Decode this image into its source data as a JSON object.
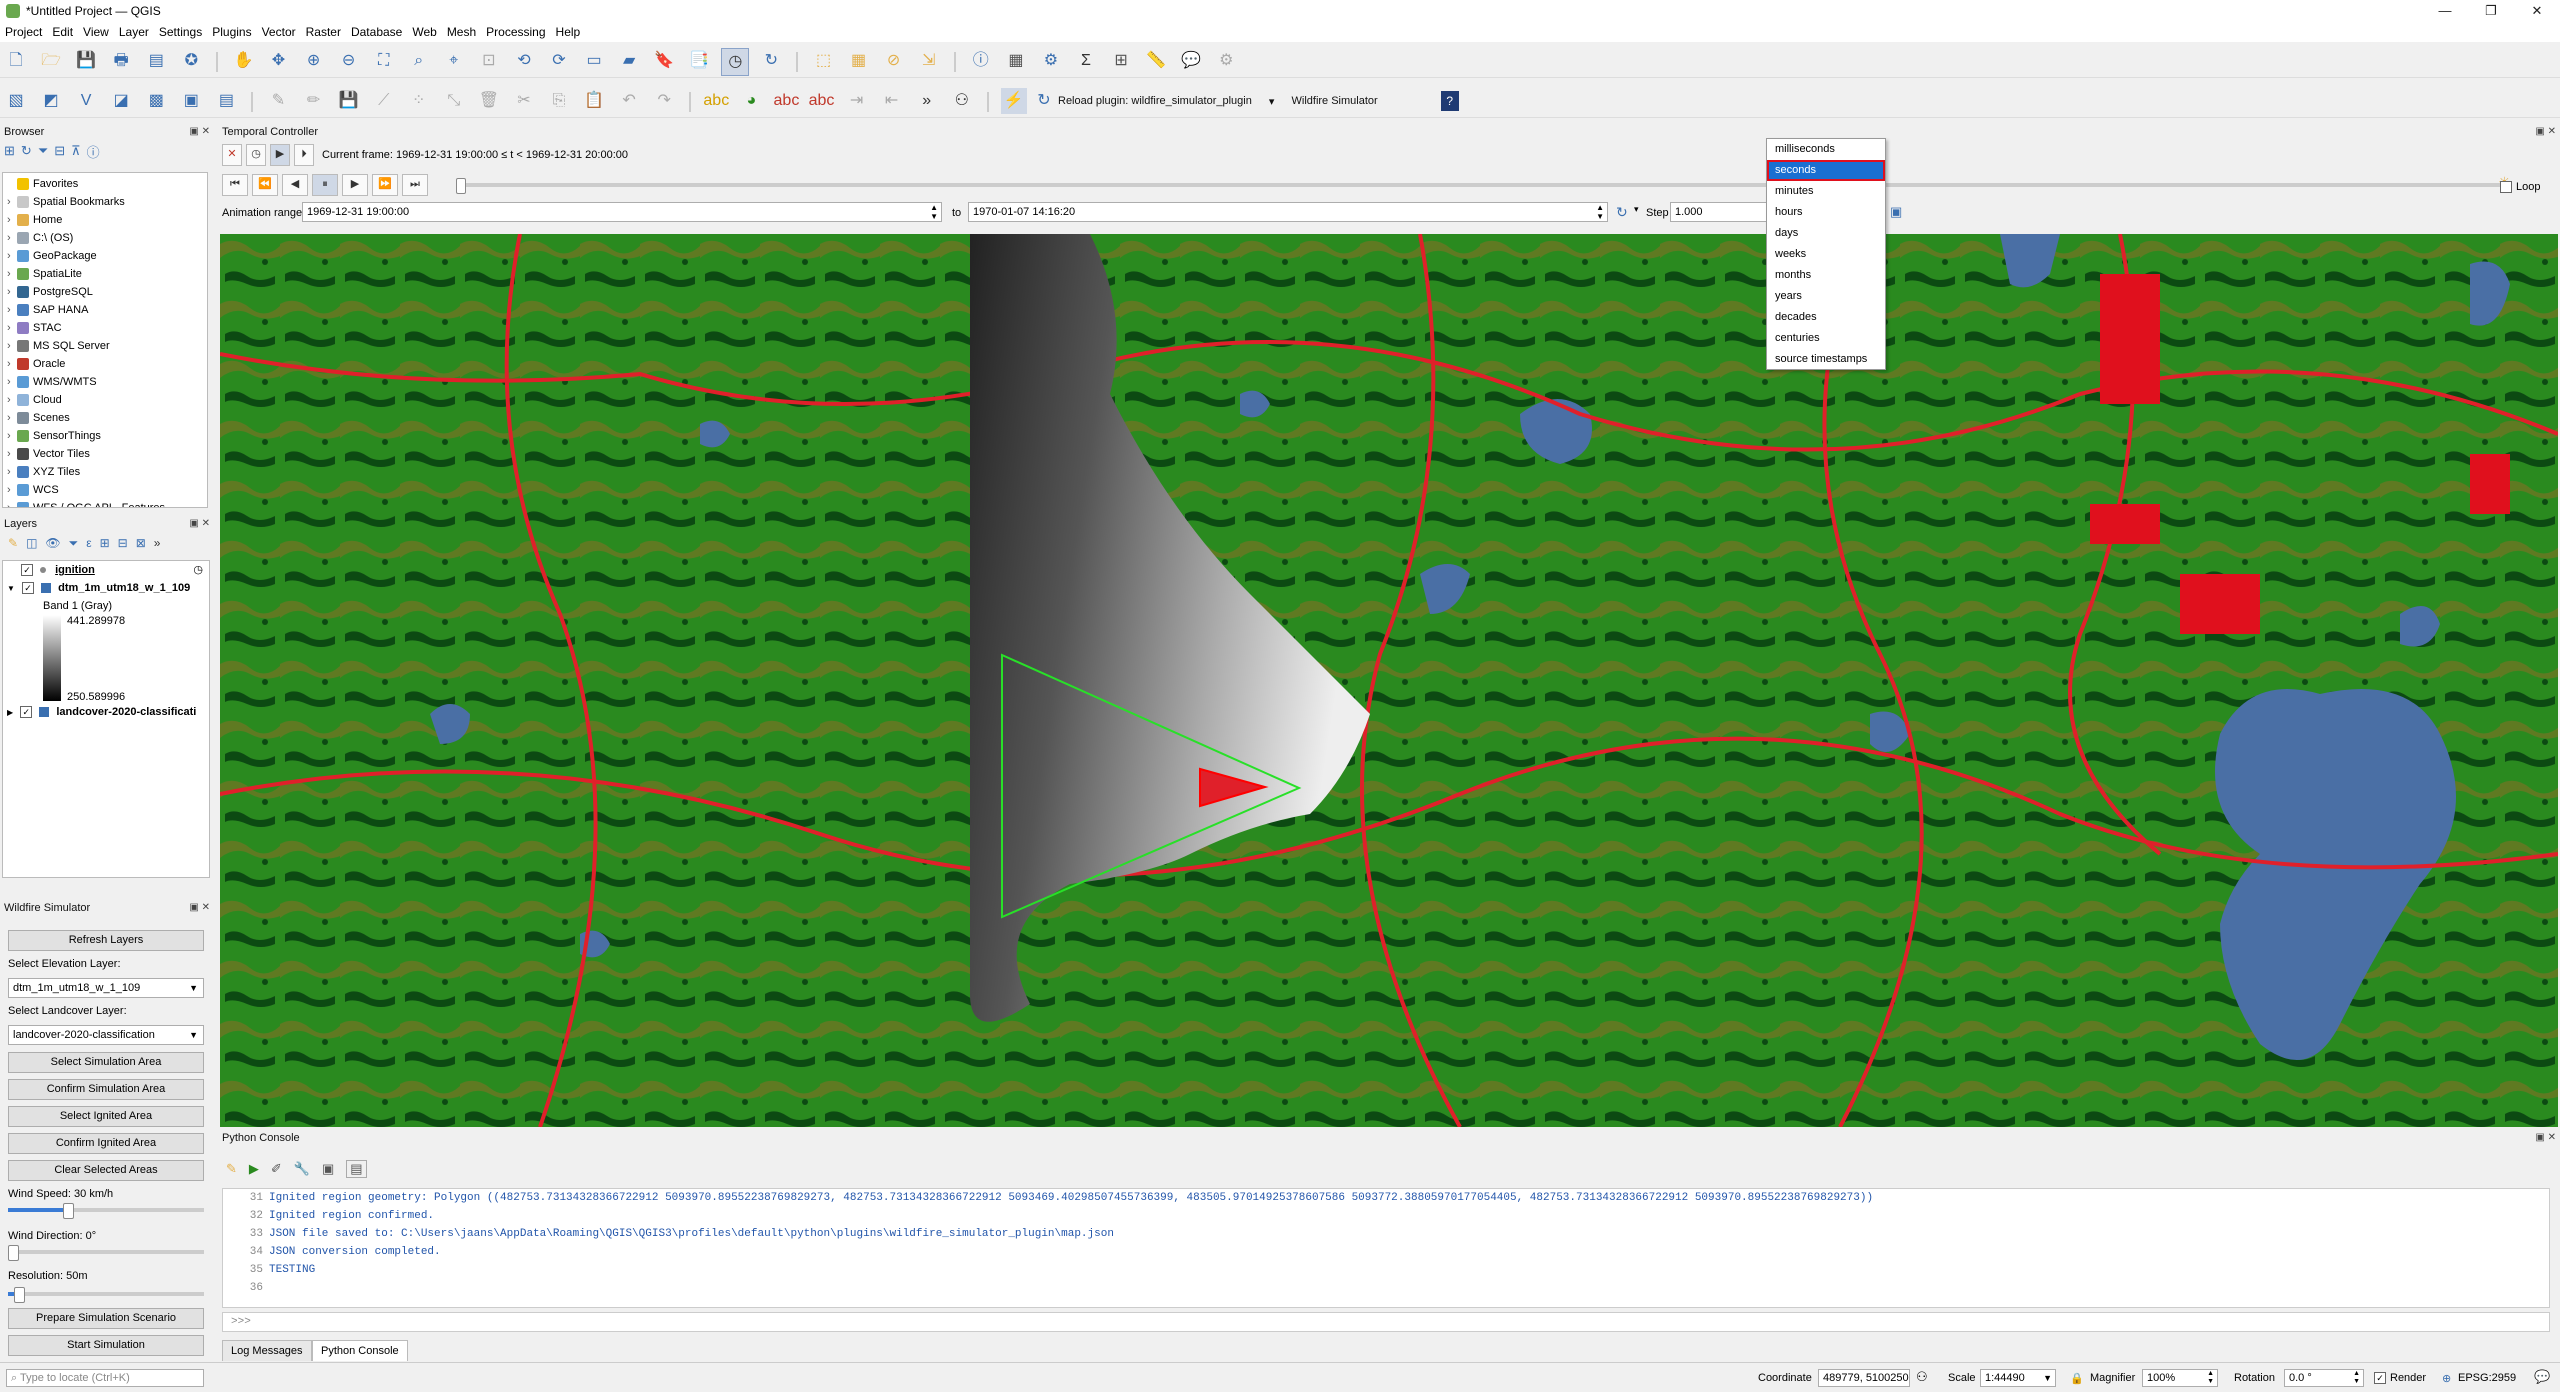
{
  "window": {
    "title": "*Untitled Project — QGIS",
    "min": "—",
    "max": "❐",
    "close": "✕"
  },
  "menu": [
    "Project",
    "Edit",
    "View",
    "Layer",
    "Settings",
    "Plugins",
    "Vector",
    "Raster",
    "Database",
    "Web",
    "Mesh",
    "Processing",
    "Help"
  ],
  "plugin_toolbar": {
    "reload_label": "Reload plugin: wildfire_simulator_plugin",
    "wildfire_label": "Wildfire Simulator"
  },
  "browser": {
    "title": "Browser",
    "items": [
      {
        "label": "Favorites",
        "color": "#f2c200"
      },
      {
        "label": "Spatial Bookmarks",
        "color": "#c8c8c8"
      },
      {
        "label": "Home",
        "color": "#e3b04b"
      },
      {
        "label": "C:\\ (OS)",
        "color": "#9aa6b2"
      },
      {
        "label": "GeoPackage",
        "color": "#5a9bd5"
      },
      {
        "label": "SpatiaLite",
        "color": "#6aa84f"
      },
      {
        "label": "PostgreSQL",
        "color": "#336791"
      },
      {
        "label": "SAP HANA",
        "color": "#4a7fbf"
      },
      {
        "label": "STAC",
        "color": "#8e7cc3"
      },
      {
        "label": "MS SQL Server",
        "color": "#777777"
      },
      {
        "label": "Oracle",
        "color": "#c0392b"
      },
      {
        "label": "WMS/WMTS",
        "color": "#5a9bd5"
      },
      {
        "label": "Cloud",
        "color": "#8fb3d9"
      },
      {
        "label": "Scenes",
        "color": "#7d8b99"
      },
      {
        "label": "SensorThings",
        "color": "#6aa84f"
      },
      {
        "label": "Vector Tiles",
        "color": "#4a4a4a"
      },
      {
        "label": "XYZ Tiles",
        "color": "#4a7fbf"
      },
      {
        "label": "WCS",
        "color": "#5a9bd5"
      },
      {
        "label": "WFS / OGC API - Features",
        "color": "#5a9bd5"
      }
    ]
  },
  "layers": {
    "title": "Layers",
    "ignition": "ignition",
    "dtm": "dtm_1m_utm18_w_1_109",
    "band": "Band 1 (Gray)",
    "max": "441.289978",
    "min": "250.589996",
    "landcover": "landcover-2020-classificati"
  },
  "wildfire": {
    "title": "Wildfire Simulator",
    "refresh": "Refresh Layers",
    "elev_label": "Select Elevation Layer:",
    "elev_value": "dtm_1m_utm18_w_1_109",
    "land_label": "Select Landcover Layer:",
    "land_value": "landcover-2020-classification",
    "select_sim": "Select Simulation Area",
    "confirm_sim": "Confirm Simulation Area",
    "select_ign": "Select Ignited Area",
    "confirm_ign": "Confirm Ignited Area",
    "clear": "Clear Selected Areas",
    "wind_speed": "Wind Speed: 30 km/h",
    "wind_speed_level": 0.3,
    "wind_dir": "Wind Direction: 0°",
    "wind_dir_level": 0,
    "resolution": "Resolution: 50m",
    "resolution_level": 0.05,
    "prepare": "Prepare Simulation Scenario",
    "start": "Start Simulation"
  },
  "temporal": {
    "title": "Temporal Controller",
    "current_frame": "Current frame: 1969-12-31 19:00:00 ≤ t < 1969-12-31 20:00:00",
    "range_label": "Animation range",
    "range_start": "1969-12-31 19:00:00",
    "to": "to",
    "range_end": "1970-01-07 14:16:20",
    "step_label": "Step",
    "step_value": "1.000",
    "loop": "Loop"
  },
  "time_units": {
    "options": [
      "milliseconds",
      "seconds",
      "minutes",
      "hours",
      "days",
      "weeks",
      "months",
      "years",
      "decades",
      "centuries",
      "source timestamps"
    ],
    "selected": "seconds"
  },
  "console": {
    "title": "Python Console",
    "lines": [
      {
        "n": "31",
        "text": "Ignited region geometry: Polygon ((482753.73134328366722912 5093970.89552238769829273, 482753.73134328366722912 5093469.40298507455736399, 483505.97014925378607586 5093772.38805970177054405, 482753.73134328366722912 5093970.89552238769829273))"
      },
      {
        "n": "32",
        "text": "Ignited region confirmed."
      },
      {
        "n": "33",
        "text": "JSON file saved to: C:\\Users\\jaans\\AppData\\Roaming\\QGIS\\QGIS3\\profiles\\default\\python\\plugins\\wildfire_simulator_plugin\\map.json"
      },
      {
        "n": "34",
        "text": "JSON conversion completed."
      },
      {
        "n": "35",
        "text": "TESTING"
      },
      {
        "n": "36",
        "text": ""
      }
    ],
    "prompt": ">>>",
    "tab_log": "Log Messages",
    "tab_python": "Python Console"
  },
  "status": {
    "locate_placeholder": "Type to locate (Ctrl+K)",
    "coordinate_label": "Coordinate",
    "coordinate": "489779, 5100250",
    "scale_label": "Scale",
    "scale": "1:44490",
    "magnifier_label": "Magnifier",
    "magnifier": "100%",
    "rotation_label": "Rotation",
    "rotation": "0.0 °",
    "render": "Render",
    "crs": "EPSG:2959"
  }
}
